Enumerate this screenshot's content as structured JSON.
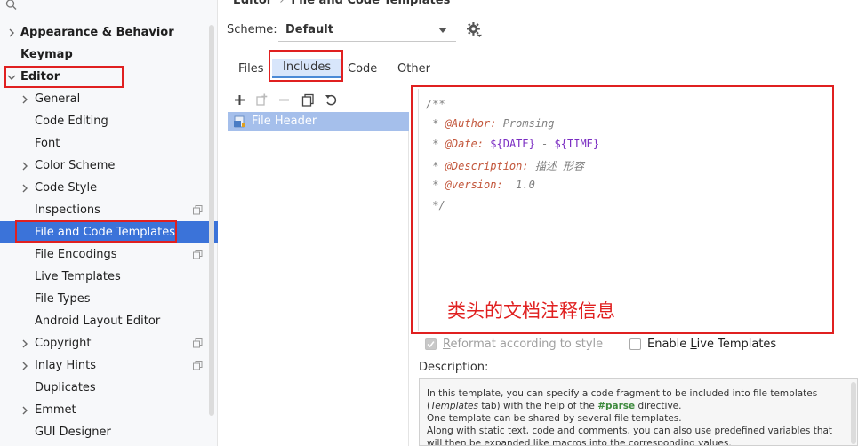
{
  "breadcrumb": {
    "root": "Editor",
    "separator": "›",
    "current": "File and Code Templates"
  },
  "sidebar": {
    "items": [
      {
        "label": "Appearance & Behavior",
        "bold": true,
        "chevron": "right"
      },
      {
        "label": "Keymap",
        "bold": true,
        "chevron": ""
      },
      {
        "label": "Editor",
        "bold": true,
        "chevron": "down"
      },
      {
        "label": "General",
        "chevron": "right"
      },
      {
        "label": "Code Editing",
        "chevron": ""
      },
      {
        "label": "Font",
        "chevron": ""
      },
      {
        "label": "Color Scheme",
        "chevron": "right"
      },
      {
        "label": "Code Style",
        "chevron": "right"
      },
      {
        "label": "Inspections",
        "chevron": "",
        "copy_icon": true
      },
      {
        "label": "File and Code Templates",
        "chevron": "",
        "selected": true
      },
      {
        "label": "File Encodings",
        "chevron": "",
        "copy_icon": true
      },
      {
        "label": "Live Templates",
        "chevron": ""
      },
      {
        "label": "File Types",
        "chevron": ""
      },
      {
        "label": "Android Layout Editor",
        "chevron": ""
      },
      {
        "label": "Copyright",
        "chevron": "right",
        "copy_icon": true
      },
      {
        "label": "Inlay Hints",
        "chevron": "right",
        "copy_icon": true
      },
      {
        "label": "Duplicates",
        "chevron": ""
      },
      {
        "label": "Emmet",
        "chevron": "right"
      },
      {
        "label": "GUI Designer",
        "chevron": ""
      }
    ]
  },
  "scheme": {
    "label": "Scheme:",
    "value": "Default"
  },
  "tabs": [
    {
      "label": "Files",
      "active": false
    },
    {
      "label": "Includes",
      "active": true
    },
    {
      "label": "Code",
      "active": false
    },
    {
      "label": "Other",
      "active": false
    }
  ],
  "template_list": {
    "items": [
      {
        "label": "File Header"
      }
    ]
  },
  "editor": {
    "lines": [
      {
        "prefix": "/**"
      },
      {
        "prefix": " * ",
        "tag": "@Author:",
        "text": " Promsing"
      },
      {
        "prefix": " * ",
        "tag": "@Date:",
        "var1": "${DATE}",
        "mid": " - ",
        "var2": "${TIME}"
      },
      {
        "prefix": " * ",
        "tag": "@Description:",
        "text": " 描述 形容"
      },
      {
        "prefix": " * ",
        "tag": "@version:",
        "text": "  1.0"
      },
      {
        "prefix": " */"
      }
    ]
  },
  "annotation": {
    "text": "类头的文档注释信息"
  },
  "options": {
    "reformat": {
      "before": "",
      "accel": "R",
      "after": "eformat according to style",
      "checked": true,
      "disabled": true
    },
    "live_templates": {
      "before": "Enable ",
      "accel": "L",
      "after": "ive Templates",
      "checked": false
    }
  },
  "description": {
    "label": "Description:",
    "p1a": "In this template, you can specify a code fragment to be included into file templates (",
    "p1b": "Templates",
    "p1c": " tab) with the help of the ",
    "p1d": "#parse",
    "p1e": " directive.",
    "p2": "One template can be shared by several file templates.",
    "p3": "Along with static text, code and comments, you can also use predefined variables that will then be expanded like macros into the corresponding values."
  },
  "colors": {
    "selection": "#3b73d9",
    "annotation": "#e02020",
    "tab_active": "#d8e6fb",
    "list_selection": "#a5bfeb"
  }
}
